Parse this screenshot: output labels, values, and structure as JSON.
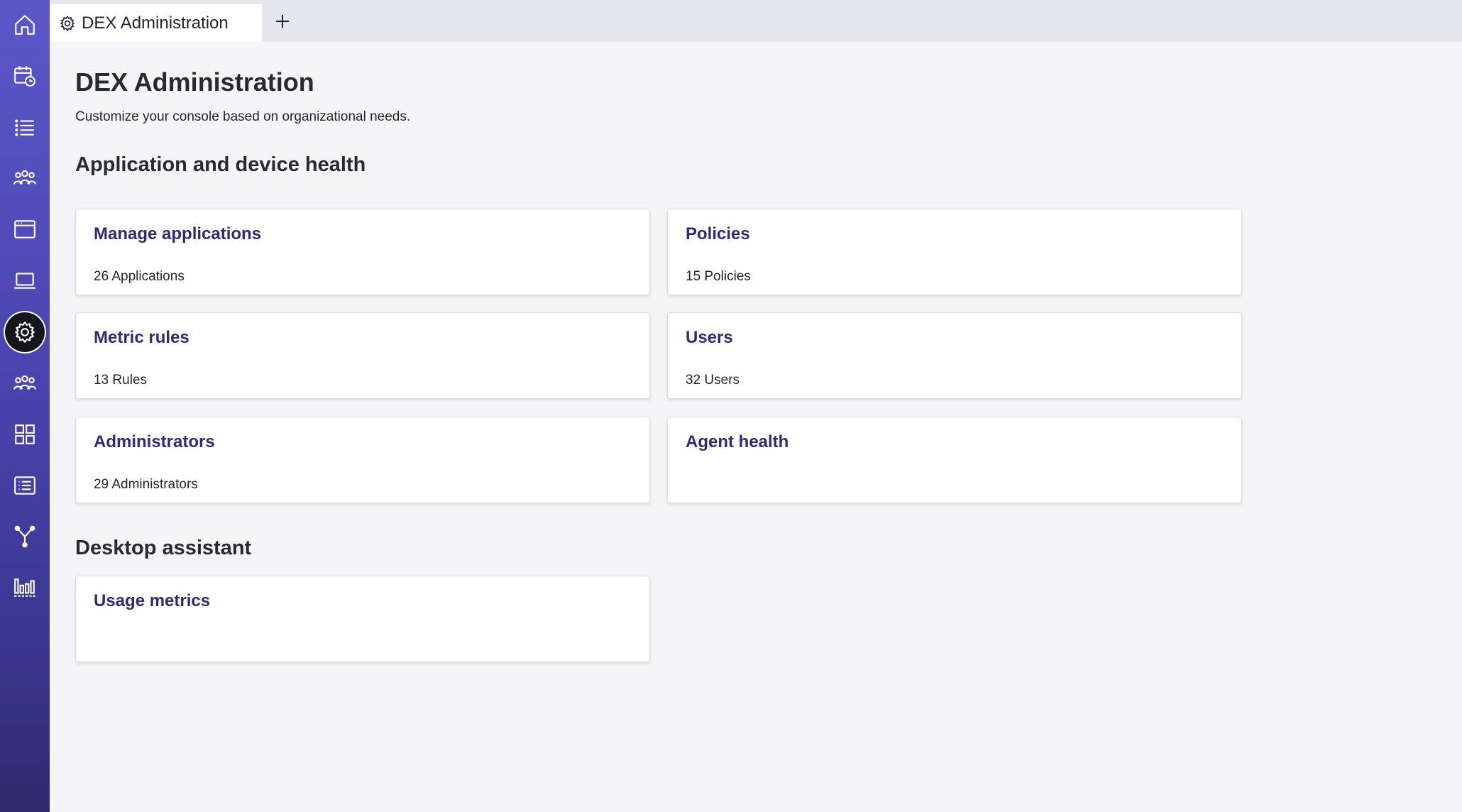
{
  "sidebar": {
    "items": [
      {
        "icon": "home-icon"
      },
      {
        "icon": "calendar-clock-icon"
      },
      {
        "icon": "list-icon"
      },
      {
        "icon": "users-group-icon"
      },
      {
        "icon": "browser-window-icon"
      },
      {
        "icon": "laptop-icon"
      },
      {
        "icon": "gear-icon",
        "active": true
      },
      {
        "icon": "users-group-icon"
      },
      {
        "icon": "grid-icon"
      },
      {
        "icon": "list-box-icon"
      },
      {
        "icon": "fork-icon"
      },
      {
        "icon": "bar-chart-icon"
      }
    ]
  },
  "tabs": [
    {
      "label": "DEX Administration",
      "icon": "gear-icon"
    }
  ],
  "page": {
    "title": "DEX Administration",
    "subtitle": "Customize your console based on organizational needs."
  },
  "sections": [
    {
      "title": "Application and device health",
      "cards": [
        {
          "title": "Manage applications",
          "count": "26 Applications"
        },
        {
          "title": "Policies",
          "count": "15 Policies"
        },
        {
          "title": "Metric rules",
          "count": "13 Rules"
        },
        {
          "title": "Users",
          "count": "32 Users"
        },
        {
          "title": "Administrators",
          "count": "29 Administrators"
        },
        {
          "title": "Agent health",
          "count": ""
        }
      ]
    },
    {
      "title": "Desktop assistant",
      "cards": [
        {
          "title": "Usage metrics",
          "count": ""
        }
      ]
    }
  ],
  "colors": {
    "accent": "#2e2a7a",
    "sidebar_top": "#5b57c9",
    "sidebar_bottom": "#2f2b6e"
  }
}
